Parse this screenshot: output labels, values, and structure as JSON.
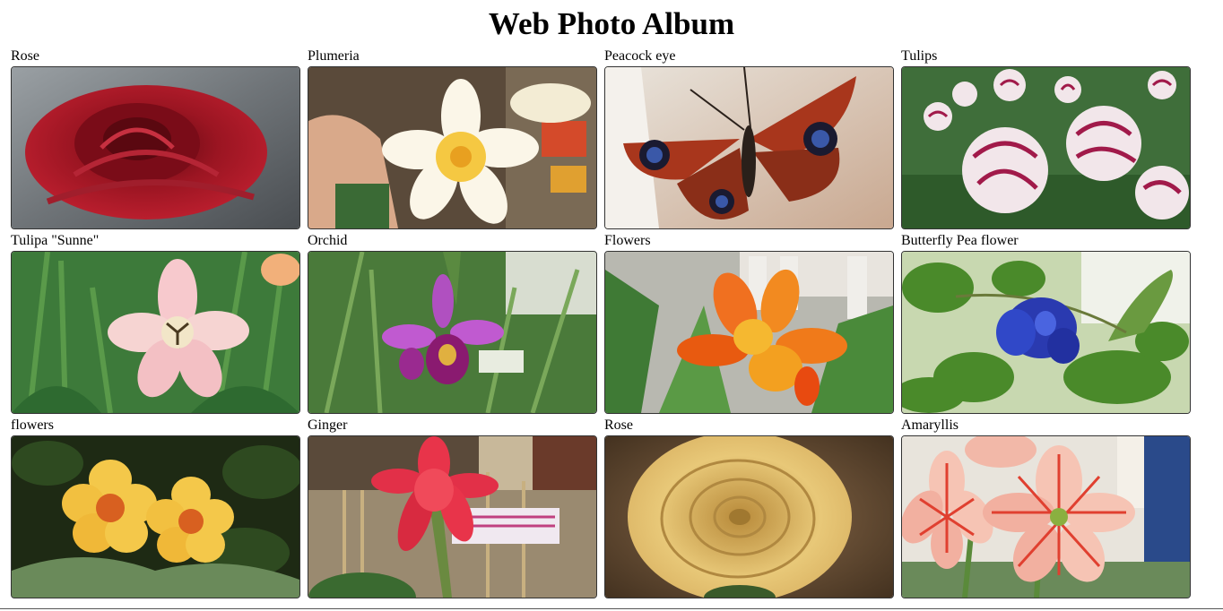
{
  "page": {
    "title": "Web Photo Album"
  },
  "album": {
    "photos": [
      {
        "caption": "Rose",
        "icon": "red-rose-photo"
      },
      {
        "caption": "Plumeria",
        "icon": "plumeria-photo"
      },
      {
        "caption": "Peacock eye",
        "icon": "peacock-butterfly-photo"
      },
      {
        "caption": "Tulips",
        "icon": "tulips-photo"
      },
      {
        "caption": "Tulipa \"Sunne\"",
        "icon": "pink-tulip-photo"
      },
      {
        "caption": "Orchid",
        "icon": "orchid-photo"
      },
      {
        "caption": "Flowers",
        "icon": "canna-flowers-photo"
      },
      {
        "caption": "Butterfly Pea flower",
        "icon": "butterfly-pea-photo"
      },
      {
        "caption": "flowers",
        "icon": "yellow-flowers-photo"
      },
      {
        "caption": "Ginger",
        "icon": "red-ginger-photo"
      },
      {
        "caption": "Rose",
        "icon": "yellow-rose-photo"
      },
      {
        "caption": "Amaryllis",
        "icon": "amaryllis-photo"
      }
    ]
  },
  "colors": {
    "text": "#000000",
    "border": "#333333",
    "background": "#ffffff"
  }
}
